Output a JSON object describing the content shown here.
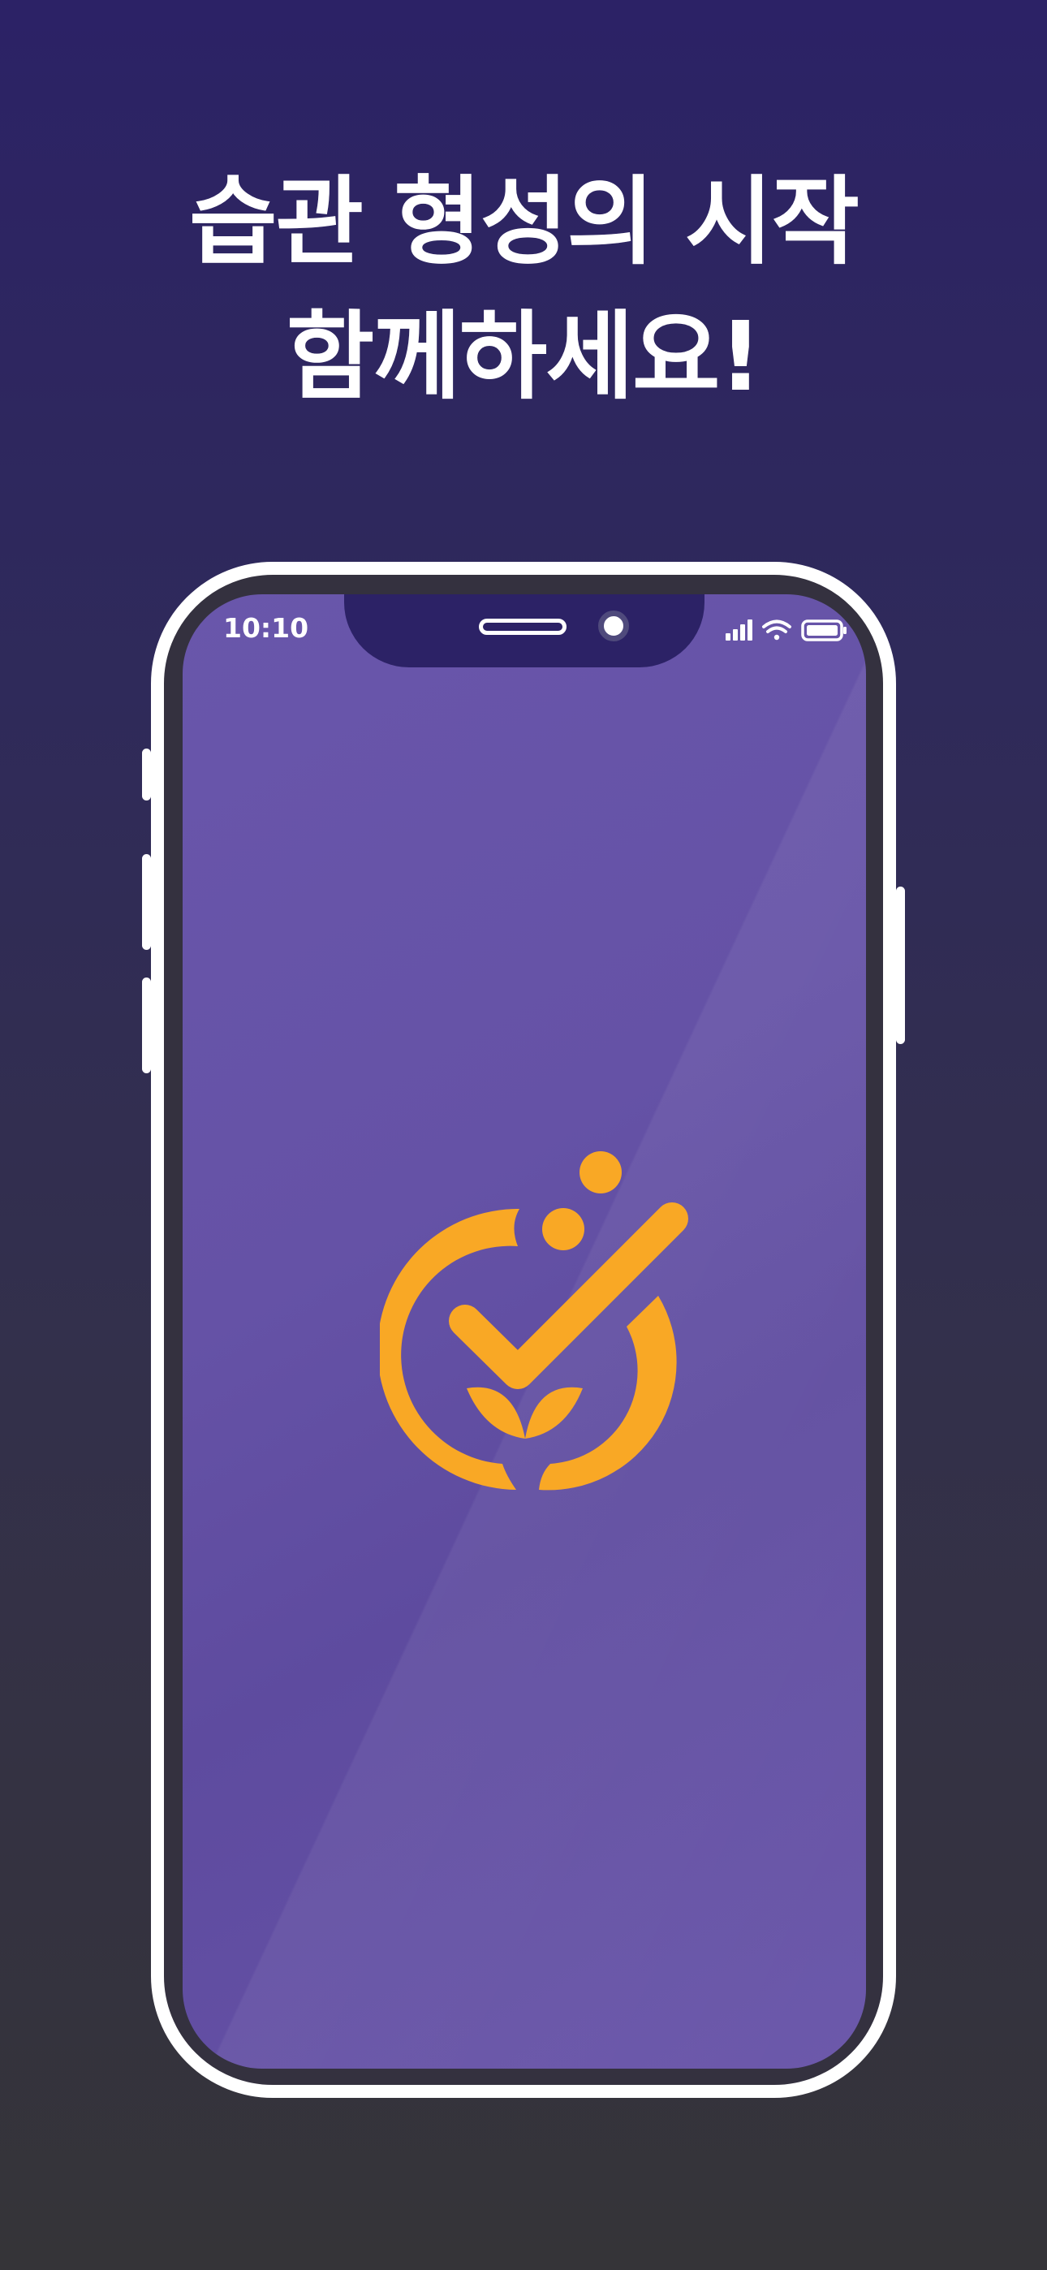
{
  "headline": {
    "line1": "습관 형성의 시작",
    "line2": "함께하세요!"
  },
  "status_bar": {
    "time": "10:10",
    "icons": [
      "cellular-signal-icon",
      "wifi-icon",
      "battery-icon"
    ]
  },
  "logo": {
    "icon": "habit-check-sprout-logo",
    "color": "#f9a825"
  },
  "colors": {
    "background_top": "#2c2266",
    "background_bottom": "#353438",
    "screen": "#6552a6",
    "accent": "#f9a825",
    "frame": "#ffffff"
  }
}
